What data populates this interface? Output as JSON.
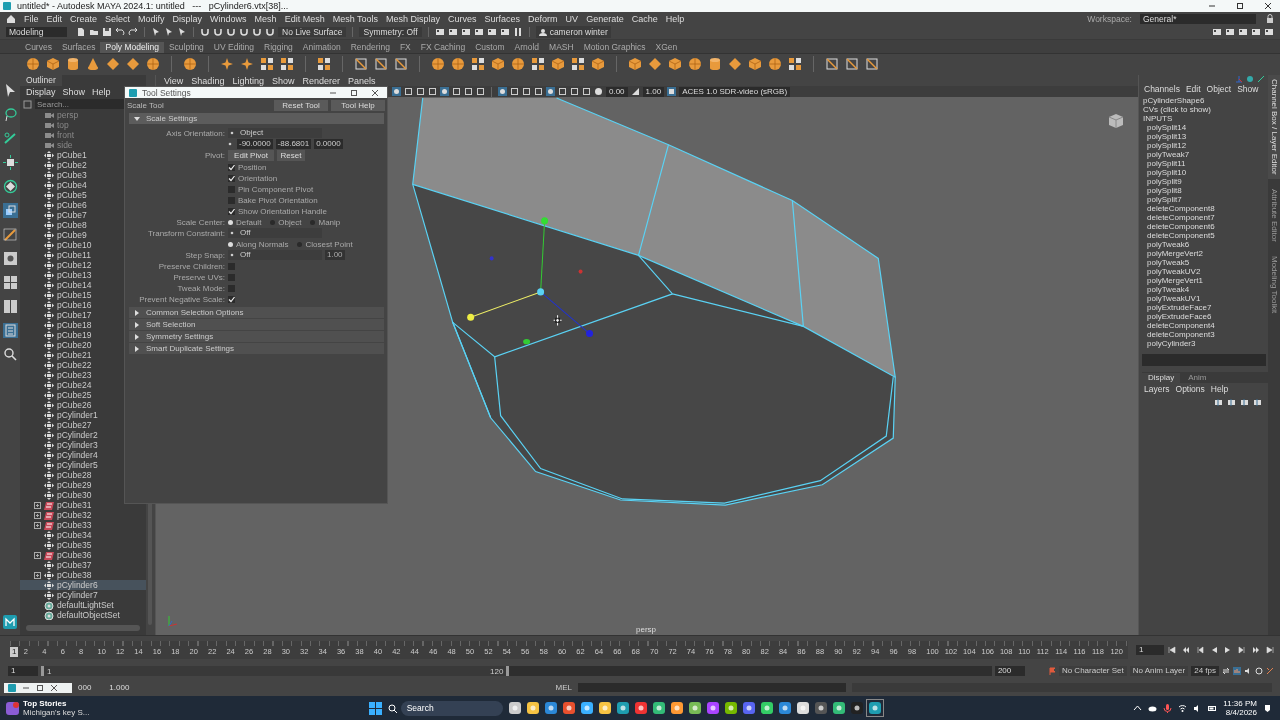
{
  "window": {
    "title": "untitled* - Autodesk MAYA 2024.1: untitled   ---   pCylinder6.vtx[38]..."
  },
  "menu_bar": [
    "File",
    "Edit",
    "Create",
    "Select",
    "Modify",
    "Display",
    "Windows",
    "Mesh",
    "Edit Mesh",
    "Mesh Tools",
    "Mesh Display",
    "Curves",
    "Surfaces",
    "Deform",
    "UV",
    "Generate",
    "Cache",
    "Help"
  ],
  "workspace": {
    "label": "Workspace:",
    "value": "General*"
  },
  "status_line": {
    "mode": "Modeling",
    "live_surface": "No Live Surface",
    "symmetry": "Symmetry: Off",
    "user": "cameron winter"
  },
  "shelf": {
    "tabs": [
      {
        "label": "Curves",
        "selected": false
      },
      {
        "label": "Surfaces",
        "selected": false
      },
      {
        "label": "Poly Modeling",
        "selected": true
      },
      {
        "label": "Sculpting",
        "selected": false
      },
      {
        "label": "UV Editing",
        "selected": false
      },
      {
        "label": "Rigging",
        "selected": false
      },
      {
        "label": "Animation",
        "selected": false
      },
      {
        "label": "Rendering",
        "selected": false
      },
      {
        "label": "FX",
        "selected": false
      },
      {
        "label": "FX Caching",
        "selected": false
      },
      {
        "label": "Custom",
        "selected": false
      },
      {
        "label": "Arnold",
        "selected": false
      },
      {
        "label": "MASH",
        "selected": false
      },
      {
        "label": "Motion Graphics",
        "selected": false
      },
      {
        "label": "XGen",
        "selected": false
      }
    ]
  },
  "outliner": {
    "title": "Outliner",
    "menu": [
      "Display",
      "Show",
      "Help"
    ],
    "search": {
      "placeholder": "Search..."
    },
    "items": [
      {
        "name": "persp",
        "kind": "camera",
        "expandable": false,
        "selected": false
      },
      {
        "name": "top",
        "kind": "camera",
        "expandable": false,
        "selected": false
      },
      {
        "name": "front",
        "kind": "camera",
        "expandable": false,
        "selected": false
      },
      {
        "name": "side",
        "kind": "camera",
        "expandable": false,
        "selected": false
      },
      {
        "name": "pCube1",
        "kind": "transform",
        "expandable": false,
        "selected": false
      },
      {
        "name": "pCube2",
        "kind": "transform",
        "expandable": false,
        "selected": false
      },
      {
        "name": "pCube3",
        "kind": "transform",
        "expandable": false,
        "selected": false
      },
      {
        "name": "pCube4",
        "kind": "transform",
        "expandable": false,
        "selected": false
      },
      {
        "name": "pCube5",
        "kind": "transform",
        "expandable": false,
        "selected": false
      },
      {
        "name": "pCube6",
        "kind": "transform",
        "expandable": false,
        "selected": false
      },
      {
        "name": "pCube7",
        "kind": "transform",
        "expandable": false,
        "selected": false
      },
      {
        "name": "pCube8",
        "kind": "transform",
        "expandable": false,
        "selected": false
      },
      {
        "name": "pCube9",
        "kind": "transform",
        "expandable": false,
        "selected": false
      },
      {
        "name": "pCube10",
        "kind": "transform",
        "expandable": false,
        "selected": false
      },
      {
        "name": "pCube11",
        "kind": "transform",
        "expandable": false,
        "selected": false
      },
      {
        "name": "pCube12",
        "kind": "transform",
        "expandable": false,
        "selected": false
      },
      {
        "name": "pCube13",
        "kind": "transform",
        "expandable": false,
        "selected": false
      },
      {
        "name": "pCube14",
        "kind": "transform",
        "expandable": false,
        "selected": false
      },
      {
        "name": "pCube15",
        "kind": "transform",
        "expandable": false,
        "selected": false
      },
      {
        "name": "pCube16",
        "kind": "transform",
        "expandable": false,
        "selected": false
      },
      {
        "name": "pCube17",
        "kind": "transform",
        "expandable": false,
        "selected": false
      },
      {
        "name": "pCube18",
        "kind": "transform",
        "expandable": false,
        "selected": false
      },
      {
        "name": "pCube19",
        "kind": "transform",
        "expandable": false,
        "selected": false
      },
      {
        "name": "pCube20",
        "kind": "transform",
        "expandable": false,
        "selected": false
      },
      {
        "name": "pCube21",
        "kind": "transform",
        "expandable": false,
        "selected": false
      },
      {
        "name": "pCube22",
        "kind": "transform",
        "expandable": false,
        "selected": false
      },
      {
        "name": "pCube23",
        "kind": "transform",
        "expandable": false,
        "selected": false
      },
      {
        "name": "pCube24",
        "kind": "transform",
        "expandable": false,
        "selected": false
      },
      {
        "name": "pCube25",
        "kind": "transform",
        "expandable": false,
        "selected": false
      },
      {
        "name": "pCube26",
        "kind": "transform",
        "expandable": false,
        "selected": false
      },
      {
        "name": "pCylinder1",
        "kind": "transform",
        "expandable": false,
        "selected": false
      },
      {
        "name": "pCube27",
        "kind": "transform",
        "expandable": false,
        "selected": false
      },
      {
        "name": "pCylinder2",
        "kind": "transform",
        "expandable": false,
        "selected": false
      },
      {
        "name": "pCylinder3",
        "kind": "transform",
        "expandable": false,
        "selected": false
      },
      {
        "name": "pCylinder4",
        "kind": "transform",
        "expandable": false,
        "selected": false
      },
      {
        "name": "pCylinder5",
        "kind": "transform",
        "expandable": false,
        "selected": false
      },
      {
        "name": "pCube28",
        "kind": "transform",
        "expandable": false,
        "selected": false
      },
      {
        "name": "pCube29",
        "kind": "transform",
        "expandable": false,
        "selected": false
      },
      {
        "name": "pCube30",
        "kind": "transform",
        "expandable": false,
        "selected": false
      },
      {
        "name": "pCube31",
        "kind": "group",
        "expandable": true,
        "selected": false
      },
      {
        "name": "pCube32",
        "kind": "group",
        "expandable": true,
        "selected": false
      },
      {
        "name": "pCube33",
        "kind": "group",
        "expandable": true,
        "selected": false
      },
      {
        "name": "pCube34",
        "kind": "transform",
        "expandable": false,
        "selected": false
      },
      {
        "name": "pCube35",
        "kind": "transform",
        "expandable": false,
        "selected": false
      },
      {
        "name": "pCube36",
        "kind": "group",
        "expandable": true,
        "selected": false
      },
      {
        "name": "pCube37",
        "kind": "transform",
        "expandable": false,
        "selected": false
      },
      {
        "name": "pCube38",
        "kind": "transform",
        "expandable": true,
        "selected": false
      },
      {
        "name": "pCylinder6",
        "kind": "transform",
        "expandable": false,
        "selected": true
      },
      {
        "name": "pCylinder7",
        "kind": "transform",
        "expandable": false,
        "selected": false
      },
      {
        "name": "defaultLightSet",
        "kind": "set",
        "expandable": false,
        "selected": false
      },
      {
        "name": "defaultObjectSet",
        "kind": "set",
        "expandable": false,
        "selected": false
      }
    ]
  },
  "viewport": {
    "menu": [
      "View",
      "Shading",
      "Lighting",
      "Show",
      "Renderer",
      "Panels"
    ],
    "exposure": "0.00",
    "gamma": "1.00",
    "color_space": "ACES 1.0 SDR-video (sRGB)",
    "camera": "persp"
  },
  "tool_settings": {
    "title": "Tool Settings",
    "tool": "Scale Tool",
    "buttons": [
      "Reset Tool",
      "Tool Help"
    ],
    "sections": [
      {
        "title": "Scale Settings",
        "expanded": true,
        "rows": [
          {
            "kind": "dropdown",
            "label": "Axis Orientation:",
            "value": "Object"
          },
          {
            "kind": "fields",
            "values": [
              "-90.0000",
              "-88.6801",
              "0.0000"
            ]
          },
          {
            "kind": "buttons",
            "label": "Pivot:",
            "buttons": [
              "Edit Pivot",
              "Reset"
            ]
          },
          {
            "kind": "checkbox",
            "text": "Position",
            "checked": true
          },
          {
            "kind": "checkbox",
            "text": "Orientation",
            "checked": true
          },
          {
            "kind": "checkbox",
            "text": "Pin Component Pivot",
            "checked": false
          },
          {
            "kind": "checkbox",
            "text": "Bake Pivot Orientation",
            "checked": false
          },
          {
            "kind": "checkbox",
            "text": "Show Orientation Handle",
            "checked": true
          },
          {
            "kind": "radios",
            "label": "Scale Center:",
            "options": [
              {
                "label": "Default",
                "selected": true
              },
              {
                "label": "Object",
                "selected": false
              },
              {
                "label": "Manip",
                "selected": false
              }
            ]
          },
          {
            "kind": "dropdown",
            "label": "Transform Constraint:",
            "value": "Off"
          },
          {
            "kind": "radios",
            "options": [
              {
                "label": "Along Normals",
                "selected": true
              },
              {
                "label": "Closest Point",
                "selected": false
              }
            ]
          },
          {
            "kind": "dropdown",
            "label": "Step Snap:",
            "value": "Off",
            "field": {
              "value": "1.00",
              "disabled": true
            }
          },
          {
            "kind": "checkbox",
            "label": "Preserve Children:",
            "checked": false
          },
          {
            "kind": "checkbox",
            "label": "Preserve UVs:",
            "checked": false
          },
          {
            "kind": "checkbox",
            "label": "Tweak Mode:",
            "checked": false
          },
          {
            "kind": "checkbox",
            "label": "Prevent Negative Scale:",
            "checked": true
          }
        ]
      },
      {
        "title": "Common Selection Options",
        "expanded": false
      },
      {
        "title": "Soft Selection",
        "expanded": false
      },
      {
        "title": "Symmetry Settings",
        "expanded": false
      },
      {
        "title": "Smart Duplicate Settings",
        "expanded": false
      }
    ]
  },
  "channel_box": {
    "menu": [
      "Channels",
      "Edit",
      "Object",
      "Show"
    ],
    "shape": "pCylinderShape6",
    "cvs": "CVs (click to show)",
    "inputs_label": "INPUTS",
    "inputs": [
      "polySplit14",
      "polySplit13",
      "polySplit12",
      "polyTweak7",
      "polySplit11",
      "polySplit10",
      "polySplit9",
      "polySplit8",
      "polySplit7",
      "deleteComponent8",
      "deleteComponent7",
      "deleteComponent6",
      "deleteComponent5",
      "polyTweak6",
      "polyMergeVert2",
      "polyTweak5",
      "polyTweakUV2",
      "polyMergeVert1",
      "polyTweak4",
      "polyTweakUV1",
      "polyExtrudeFace7",
      "polyExtrudeFace6",
      "deleteComponent4",
      "deleteComponent3",
      "polyCylinder3"
    ],
    "layer_tabs": [
      {
        "label": "Display",
        "selected": true
      },
      {
        "label": "Anim",
        "selected": false
      }
    ],
    "layer_menu": [
      "Layers",
      "Options",
      "Help"
    ]
  },
  "side_tabs": [
    {
      "label": "Channel Box / Layer Editor",
      "selected": true
    },
    {
      "label": "Attribute Editor",
      "selected": false
    },
    {
      "label": "Modeling Toolkit",
      "selected": false
    }
  ],
  "timeline": {
    "current_frame": "1",
    "ticks": [
      "2",
      "4",
      "6",
      "8",
      "10",
      "12",
      "14",
      "16",
      "18",
      "20",
      "22",
      "24",
      "26",
      "28",
      "30",
      "32",
      "34",
      "36",
      "38",
      "40",
      "42",
      "44",
      "46",
      "48",
      "50",
      "52",
      "54",
      "56",
      "58",
      "60",
      "62",
      "64",
      "66",
      "68",
      "70",
      "72",
      "74",
      "76",
      "78",
      "80",
      "82",
      "84",
      "86",
      "88",
      "90",
      "92",
      "94",
      "96",
      "98",
      "100",
      "102",
      "104",
      "106",
      "108",
      "110",
      "112",
      "114",
      "116",
      "118",
      "120"
    ],
    "frame_field": "1"
  },
  "range_slider": {
    "start_field": "1",
    "start": "1",
    "end": "120",
    "end_field": "200",
    "character_set": "No Character Set",
    "anim_layer": "No Anim Layer",
    "fps": "24 fps"
  },
  "command_line": {
    "values": [
      "000",
      "1.000"
    ],
    "language": "MEL"
  },
  "taskbar": {
    "news_title": "Top Stories",
    "news_text": "Michigan's key S...",
    "search": {
      "placeholder": "Search"
    },
    "time": "11:36 PM",
    "date": "8/4/2026"
  }
}
